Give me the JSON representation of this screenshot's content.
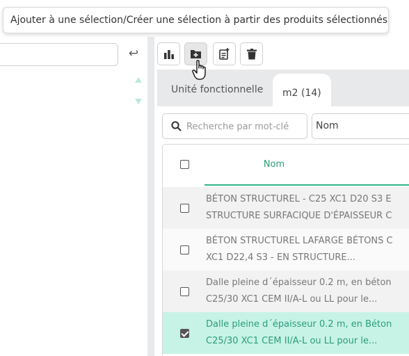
{
  "tooltip": {
    "text": "Ajouter à une sélection/Créer une sélection à partir des produits sélectionnés"
  },
  "left_panel": {
    "search_value": "",
    "return_icon": "return-arrow-icon"
  },
  "toolbar": {
    "buttons": [
      {
        "name": "chart-button",
        "icon": "bar-chart-icon",
        "active": false
      },
      {
        "name": "add-to-selection-button",
        "icon": "folder-plus-icon",
        "active": true
      },
      {
        "name": "new-document-button",
        "icon": "document-plus-icon",
        "active": false
      },
      {
        "name": "delete-button",
        "icon": "trash-icon",
        "active": false
      }
    ]
  },
  "tabs": [
    {
      "label": "Unité fonctionnelle",
      "active": false
    },
    {
      "label": "m2 (14)",
      "active": true
    }
  ],
  "search": {
    "placeholder": "Recherche par mot-clé",
    "value": ""
  },
  "sort": {
    "selected": "Nom"
  },
  "table": {
    "header": {
      "nom": "Nom"
    },
    "rows": [
      {
        "line1": "BÉTON STRUCTUREL - C25 XC1 D20 S3 E",
        "line2": "STRUCTURE SURFACIQUE D'ÉPAISSEUR C",
        "checked": false
      },
      {
        "line1": "BÉTON STRUCTUREL LAFARGE BÉTONS C",
        "line2": "XC1 D22,4 S3 - EN STRUCTURE...",
        "checked": false
      },
      {
        "line1": "Dalle pleine d´épaisseur 0.2 m, en béton",
        "line2": "C25/30 XC1 CEM II/A-L ou LL pour le...",
        "checked": false
      },
      {
        "line1": "Dalle pleine d´épaisseur 0.2 m, en Béton",
        "line2": "C25/30 XC1 CEM II/A-L ou LL pour le...",
        "checked": true
      }
    ]
  },
  "colors": {
    "accent": "#2fb58a",
    "selected_row": "#c7f3e6",
    "tab_bar": "#e8e9eb"
  }
}
